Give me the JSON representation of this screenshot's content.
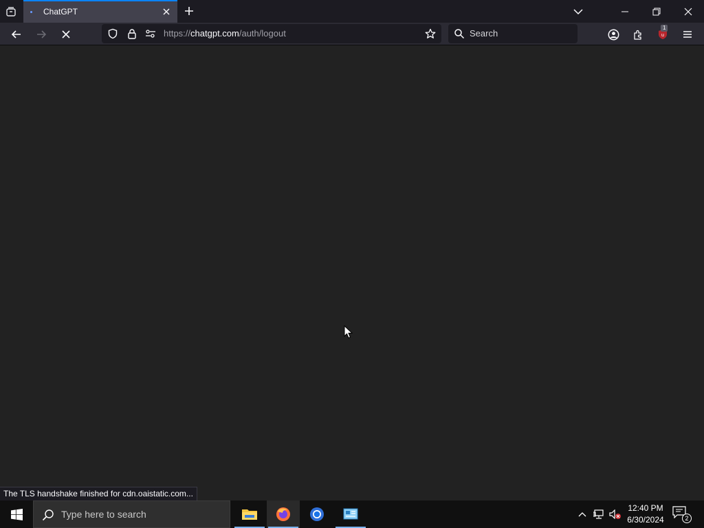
{
  "browser": {
    "tab": {
      "title": "ChatGPT"
    },
    "url": {
      "scheme": "https://",
      "domain": "chatgpt.com",
      "path": "/auth/logout"
    },
    "search_placeholder": "Search",
    "extension_badge": "1",
    "status_text": "The TLS handshake finished for cdn.oaistatic.com...",
    "colors": {
      "tab_accent": "#0a84ff",
      "page_bg": "#222222",
      "ublock": "#b6262c"
    }
  },
  "taskbar": {
    "search_placeholder": "Type here to search",
    "apps": [
      {
        "name": "File Explorer",
        "icon": "folder-icon"
      },
      {
        "name": "Firefox",
        "icon": "firefox-icon"
      },
      {
        "name": "Chrome",
        "icon": "chrome-icon"
      },
      {
        "name": "Control Panel",
        "icon": "control-panel-icon"
      }
    ],
    "clock": {
      "time": "12:40 PM",
      "date": "6/30/2024"
    },
    "notification_count": "2"
  }
}
